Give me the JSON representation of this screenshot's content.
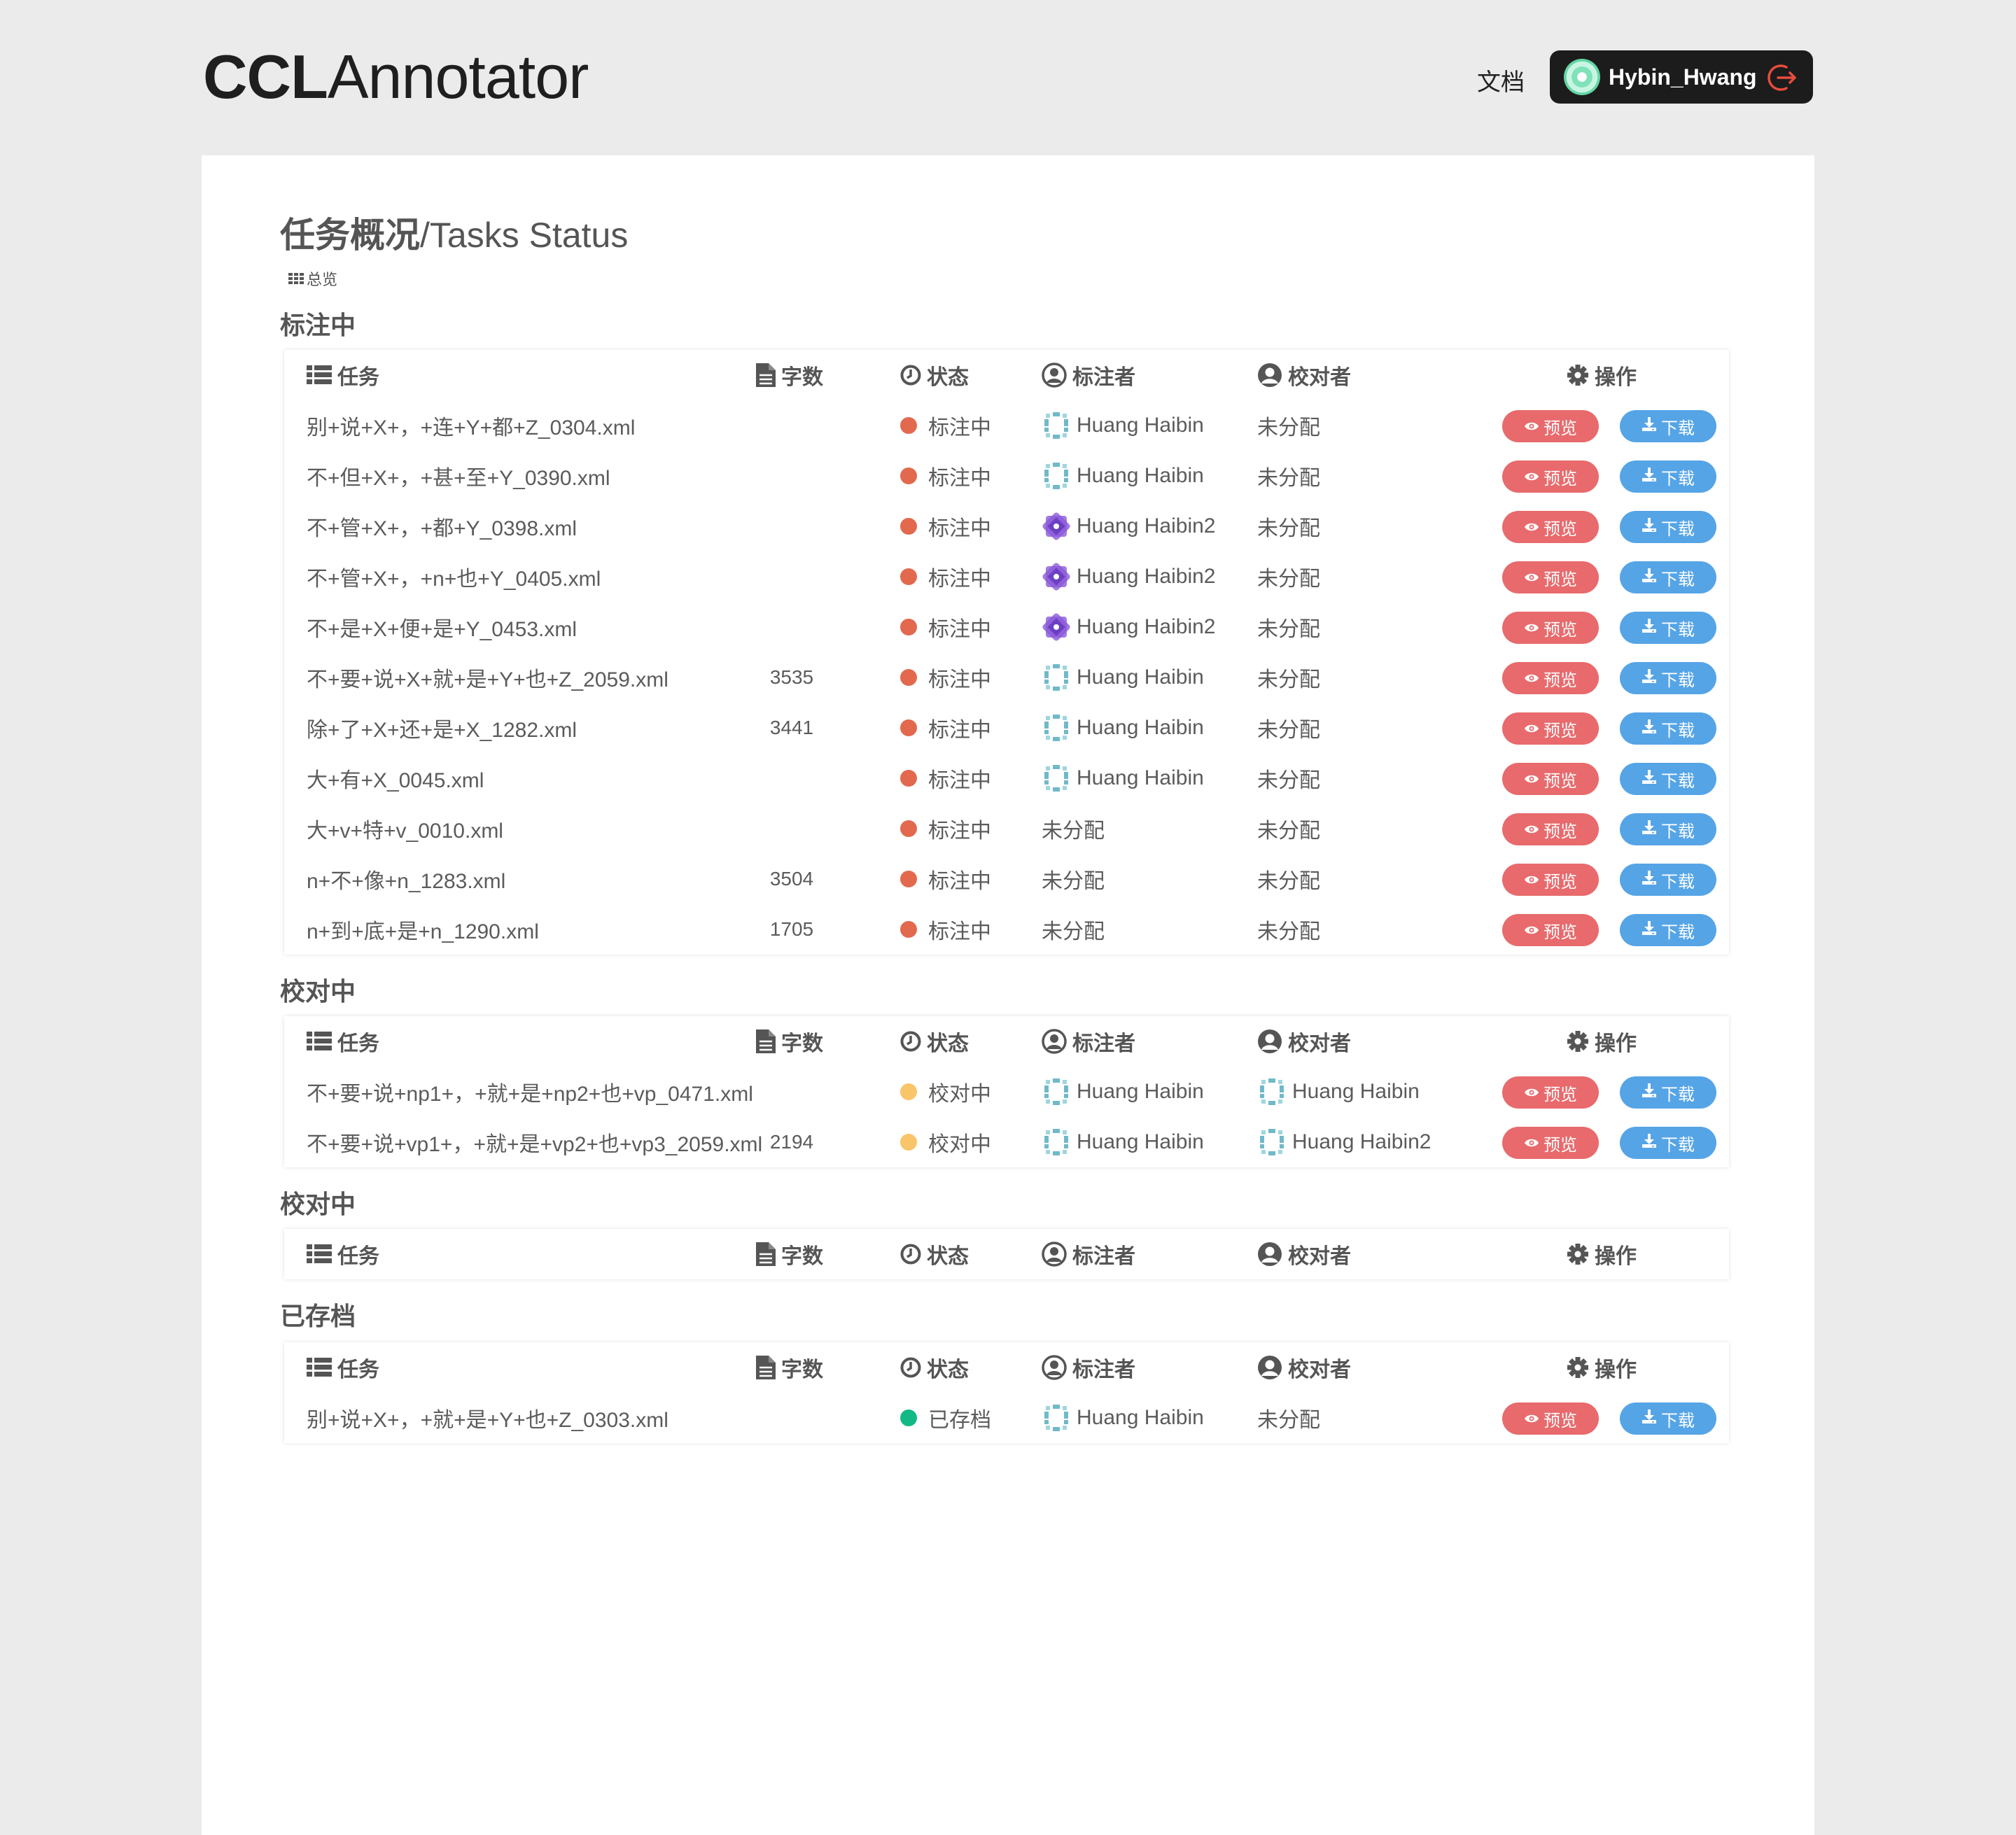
{
  "header": {
    "logo_bold": "CCL",
    "logo_light": "Annotator",
    "doc_link": "文档",
    "user_name": "Hybin_Hwang"
  },
  "page": {
    "title_zh": "任务概况",
    "title_en": "/Tasks Status",
    "overview": "总览"
  },
  "columns": {
    "task": "任务",
    "count": "字数",
    "status": "状态",
    "annotator": "标注者",
    "reviewer": "校对者",
    "ops": "操作"
  },
  "buttons": {
    "preview": "预览",
    "download": "下载"
  },
  "sections": [
    {
      "title": "标注中",
      "rows": [
        {
          "task": "别+说+X+，+连+Y+都+Z_0304.xml",
          "count": "",
          "status": "标注中",
          "status_color": "red",
          "annotator": "Huang Haibin",
          "ann_icon": "teal",
          "reviewer": "未分配",
          "rev_icon": ""
        },
        {
          "task": "不+但+X+，+甚+至+Y_0390.xml",
          "count": "",
          "status": "标注中",
          "status_color": "red",
          "annotator": "Huang Haibin",
          "ann_icon": "teal",
          "reviewer": "未分配",
          "rev_icon": ""
        },
        {
          "task": "不+管+X+，+都+Y_0398.xml",
          "count": "",
          "status": "标注中",
          "status_color": "red",
          "annotator": "Huang Haibin2",
          "ann_icon": "purple",
          "reviewer": "未分配",
          "rev_icon": ""
        },
        {
          "task": "不+管+X+，+n+也+Y_0405.xml",
          "count": "",
          "status": "标注中",
          "status_color": "red",
          "annotator": "Huang Haibin2",
          "ann_icon": "purple",
          "reviewer": "未分配",
          "rev_icon": ""
        },
        {
          "task": "不+是+X+便+是+Y_0453.xml",
          "count": "",
          "status": "标注中",
          "status_color": "red",
          "annotator": "Huang Haibin2",
          "ann_icon": "purple",
          "reviewer": "未分配",
          "rev_icon": ""
        },
        {
          "task": "不+要+说+X+就+是+Y+也+Z_2059.xml",
          "count": "3535",
          "status": "标注中",
          "status_color": "red",
          "annotator": "Huang Haibin",
          "ann_icon": "teal",
          "reviewer": "未分配",
          "rev_icon": ""
        },
        {
          "task": "除+了+X+还+是+X_1282.xml",
          "count": "3441",
          "status": "标注中",
          "status_color": "red",
          "annotator": "Huang Haibin",
          "ann_icon": "teal",
          "reviewer": "未分配",
          "rev_icon": ""
        },
        {
          "task": "大+有+X_0045.xml",
          "count": "",
          "status": "标注中",
          "status_color": "red",
          "annotator": "Huang Haibin",
          "ann_icon": "teal",
          "reviewer": "未分配",
          "rev_icon": ""
        },
        {
          "task": "大+v+特+v_0010.xml",
          "count": "",
          "status": "标注中",
          "status_color": "red",
          "annotator": "未分配",
          "ann_icon": "",
          "reviewer": "未分配",
          "rev_icon": ""
        },
        {
          "task": "n+不+像+n_1283.xml",
          "count": "3504",
          "status": "标注中",
          "status_color": "red",
          "annotator": "未分配",
          "ann_icon": "",
          "reviewer": "未分配",
          "rev_icon": ""
        },
        {
          "task": "n+到+底+是+n_1290.xml",
          "count": "1705",
          "status": "标注中",
          "status_color": "red",
          "annotator": "未分配",
          "ann_icon": "",
          "reviewer": "未分配",
          "rev_icon": ""
        }
      ]
    },
    {
      "title": "校对中",
      "rows": [
        {
          "task": "不+要+说+np1+，+就+是+np2+也+vp_0471.xml",
          "count": "",
          "status": "校对中",
          "status_color": "yellow",
          "annotator": "Huang Haibin",
          "ann_icon": "teal",
          "reviewer": "Huang Haibin",
          "rev_icon": "teal"
        },
        {
          "task": "不+要+说+vp1+，+就+是+vp2+也+vp3_2059.xml",
          "count": "2194",
          "status": "校对中",
          "status_color": "yellow",
          "annotator": "Huang Haibin",
          "ann_icon": "teal",
          "reviewer": "Huang Haibin2",
          "rev_icon": "teal"
        }
      ]
    },
    {
      "title": "校对中",
      "rows": []
    },
    {
      "title": "已存档",
      "rows": [
        {
          "task": "别+说+X+，+就+是+Y+也+Z_0303.xml",
          "count": "",
          "status": "已存档",
          "status_color": "green",
          "annotator": "Huang Haibin",
          "ann_icon": "teal",
          "reviewer": "未分配",
          "rev_icon": ""
        }
      ]
    }
  ]
}
